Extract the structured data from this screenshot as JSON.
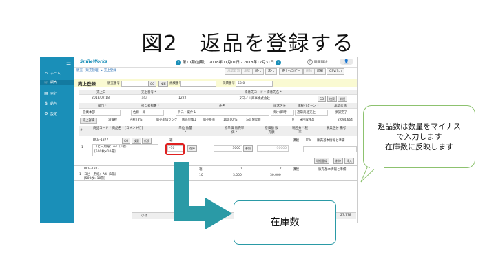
{
  "slide": {
    "title": "図2　返品を登録する"
  },
  "sidebar": {
    "items": [
      {
        "icon": "home-icon",
        "glyph": "⌂",
        "label": "ホーム"
      },
      {
        "icon": "cart-icon",
        "glyph": "🛒",
        "label": "販売"
      },
      {
        "icon": "document-icon",
        "glyph": "▤",
        "label": "会計"
      },
      {
        "icon": "money-icon",
        "glyph": "$",
        "label": "給与"
      },
      {
        "icon": "gear-icon",
        "glyph": "⚙",
        "label": "設定"
      }
    ],
    "menu_glyph": "☰"
  },
  "topbar": {
    "logo": "SmileWorks",
    "prev_glyph": "‹",
    "period": "第10期(当期)：2018年01月01日 - 2018年12月31日",
    "next_glyph": "›",
    "help": "画面解説",
    "user_glyph": "👤"
  },
  "breadcrumb": "販売（販売管理）▸ 売上登録",
  "toolbar": {
    "buttons": [
      "承認取消",
      "承認",
      "前へ",
      "次へ",
      "売上へコピー",
      "削除",
      "印刷",
      "CSV出力"
    ]
  },
  "form": {
    "title": "売上登録",
    "sales_no_label": "販売番号",
    "go": "GO",
    "search": "検索",
    "new": "新規",
    "tax_label": "規模番号",
    "voucher_label": "伝票番号",
    "voucher_value": "58-0"
  },
  "header1": {
    "cols": [
      "売上日",
      "売上番号 *",
      "",
      "得意先コード * 得意先名 *"
    ],
    "values": [
      "2018/07/18",
      "142",
      "1222",
      "スマイル商事株式会社"
    ]
  },
  "header2": {
    "cols": [
      "部門 *",
      "担当者部署 *",
      "件名",
      "請求区分",
      "課税パターン *",
      "承認状態"
    ],
    "values": [
      "営業本部",
      "佐藤一郎",
      "テスト案件１",
      "掛け(即時)",
      "通常商品売上",
      "承認完了"
    ]
  },
  "taxbar": {
    "items": [
      "売上詳細",
      "消費税",
      "内税 (8%)",
      "販売単価ランク",
      "販売単価１",
      "販売掛率",
      "100.00 %",
      "与信限度額",
      "0",
      "未回収残高",
      "2,694,664"
    ]
  },
  "detail": {
    "headers": [
      "#",
      "商品コード * 商品名 * [コメント行]",
      "単位 数量 *",
      "原単価 販売単価 *",
      "原価額 販売額",
      "税区分 * 税率",
      "事業区分 備考"
    ],
    "row": {
      "num": "1",
      "code": "BCB-1877",
      "name": "コピー用紙：A4（1箱）",
      "spec": "[500枚×10冊]",
      "unit": "箱",
      "qty": "-10",
      "qty_btn": "在庫",
      "unit_price": "3000",
      "price_btn": "参照",
      "amount": "-30000",
      "tax": "課税",
      "tax_rate": "8%",
      "business": "販売基本情報と準備"
    },
    "actions": [
      "明細登録",
      "削除",
      "挿入"
    ]
  },
  "summary": {
    "row": {
      "num": "1",
      "code": "BCB-1877",
      "name": "コピー用紙：A4（1箱）",
      "spec": "[500枚×10冊]",
      "unit": "箱",
      "qty": "10",
      "cost": "0",
      "price": "3,000",
      "amount_cost": "0",
      "amount": "30,000",
      "tax": "課税",
      "business": "販売基本情報と準備"
    },
    "subtotal_label": "小計",
    "total": "27,778"
  },
  "callout": {
    "lines": [
      "返品数は数量をマイナス",
      "で入力します",
      "在庫数に反映します"
    ]
  },
  "stock_label": "在庫数"
}
